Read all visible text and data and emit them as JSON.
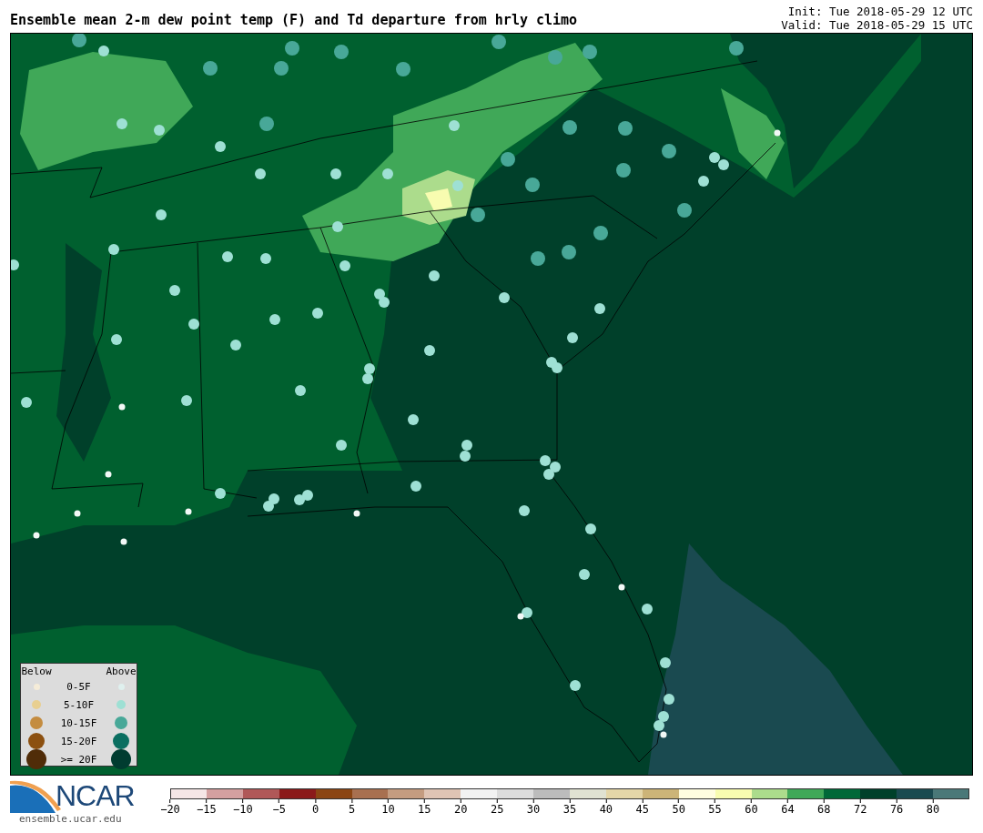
{
  "header": {
    "title": "Ensemble mean 2-m dew point temp (F) and Td departure from hrly climo",
    "init": "Init: Tue 2018-05-29 12 UTC",
    "valid": "Valid: Tue 2018-05-29 15 UTC"
  },
  "legend": {
    "below_label": "Below",
    "above_label": "Above",
    "rows": [
      {
        "label": "0-5F",
        "below": {
          "color": "#f5ecd8"
        },
        "above": {
          "color": "#dff0ee"
        }
      },
      {
        "label": "5-10F",
        "below": {
          "color": "#e8cf90"
        },
        "above": {
          "color": "#9ee0d4"
        }
      },
      {
        "label": "10-15F",
        "below": {
          "color": "#c48c40"
        },
        "above": {
          "color": "#48a898"
        }
      },
      {
        "label": "15-20F",
        "below": {
          "color": "#8c5010"
        },
        "above": {
          "color": "#0a6e60"
        }
      },
      {
        "label": ">= 20F",
        "below": {
          "color": "#502c08"
        },
        "above": {
          "color": "#003c30"
        }
      }
    ]
  },
  "footer": {
    "logo_text": "NCAR",
    "url": "ensemble.ucar.edu"
  },
  "colorbar": {
    "bins": [
      {
        "color": "#f5e6e6"
      },
      {
        "color": "#d4a0a0"
      },
      {
        "color": "#b05858"
      },
      {
        "color": "#8b1a1a"
      },
      {
        "color": "#8b4513"
      },
      {
        "color": "#a87050"
      },
      {
        "color": "#c49c80"
      },
      {
        "color": "#dfc4b4"
      },
      {
        "color": "#f2f2f2"
      },
      {
        "color": "#dcdcdc"
      },
      {
        "color": "#bcbcbc"
      },
      {
        "color": "#e0e2d2"
      },
      {
        "color": "#e4d6a8"
      },
      {
        "color": "#ccb478"
      },
      {
        "color": "#fffde0"
      },
      {
        "color": "#f8fcb0"
      },
      {
        "color": "#acdc8c"
      },
      {
        "color": "#40a858"
      },
      {
        "color": "#006838"
      },
      {
        "color": "#00402a"
      },
      {
        "color": "#1a4a50"
      },
      {
        "color": "#4a7878"
      }
    ],
    "ticks": [
      "−20",
      "−15",
      "−10",
      "−5",
      "0",
      "5",
      "10",
      "15",
      "20",
      "25",
      "30",
      "35",
      "40",
      "45",
      "50",
      "55",
      "60",
      "64",
      "68",
      "72",
      "76",
      "80"
    ]
  }
}
